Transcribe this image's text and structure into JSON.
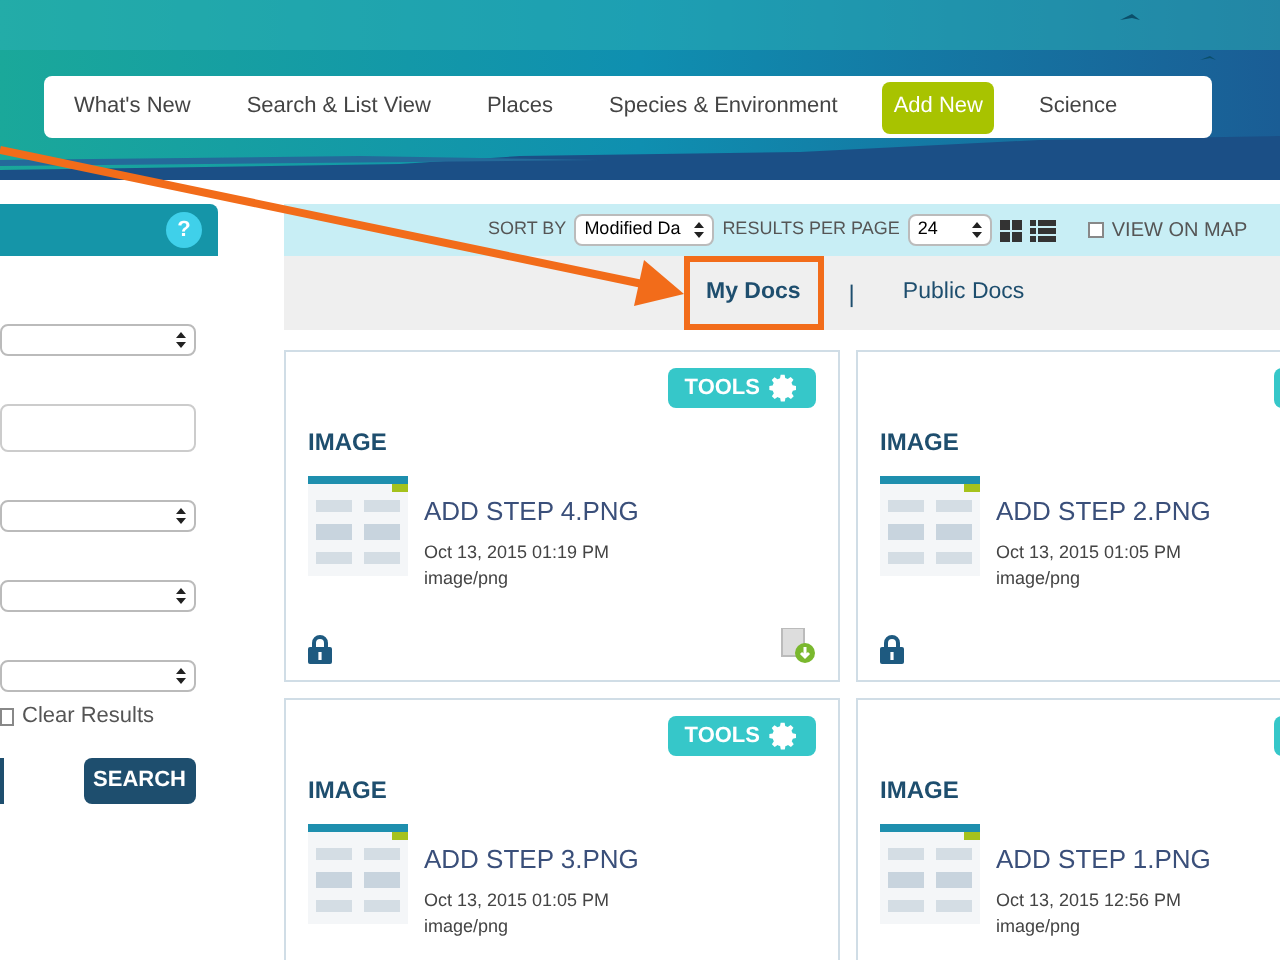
{
  "nav": [
    {
      "label": "What's New",
      "selected": false
    },
    {
      "label": "Search & List View",
      "selected": false
    },
    {
      "label": "Places",
      "selected": false
    },
    {
      "label": "Species & Environment",
      "selected": false
    },
    {
      "label": "Add New",
      "selected": true
    },
    {
      "label": "Science",
      "selected": false
    }
  ],
  "sidebar": {
    "help": "?",
    "fields": [
      {
        "kind": "select"
      },
      {
        "kind": "input"
      },
      {
        "kind": "select"
      },
      {
        "kind": "select"
      },
      {
        "kind": "select"
      }
    ],
    "clear": {
      "label": "Clear Results",
      "checked": false
    },
    "search": "SEARCH"
  },
  "toolbar": {
    "sort_label": "SORT BY",
    "sort_value": "Modified Da",
    "per_page_label": "RESULTS PER PAGE",
    "per_page_value": "24",
    "view_on_map": {
      "label": "VIEW ON MAP",
      "checked": false
    }
  },
  "tabs": [
    {
      "label": "My Docs",
      "selected": true
    },
    {
      "label": "|",
      "kind": "divider"
    },
    {
      "label": "Public Docs",
      "selected": false
    }
  ],
  "cards": [
    {
      "tools": "TOOLS",
      "type": "IMAGE",
      "title": "ADD STEP 4.PNG",
      "date": "Oct 13, 2015 01:19 PM",
      "mime": "image/png",
      "locked": true,
      "download": true
    },
    {
      "type": "IMAGE",
      "title": "ADD STEP 2.PNG",
      "date": "Oct 13, 2015 01:05 PM",
      "mime": "image/png",
      "locked": true,
      "download": false
    },
    {
      "tools": "TOOLS",
      "type": "IMAGE",
      "title": "ADD STEP 3.PNG",
      "date": "Oct 13, 2015 01:05 PM",
      "mime": "image/png"
    },
    {
      "type": "IMAGE",
      "title": "ADD STEP 1.PNG",
      "date": "Oct 13, 2015 12:56 PM",
      "mime": "image/png"
    }
  ]
}
